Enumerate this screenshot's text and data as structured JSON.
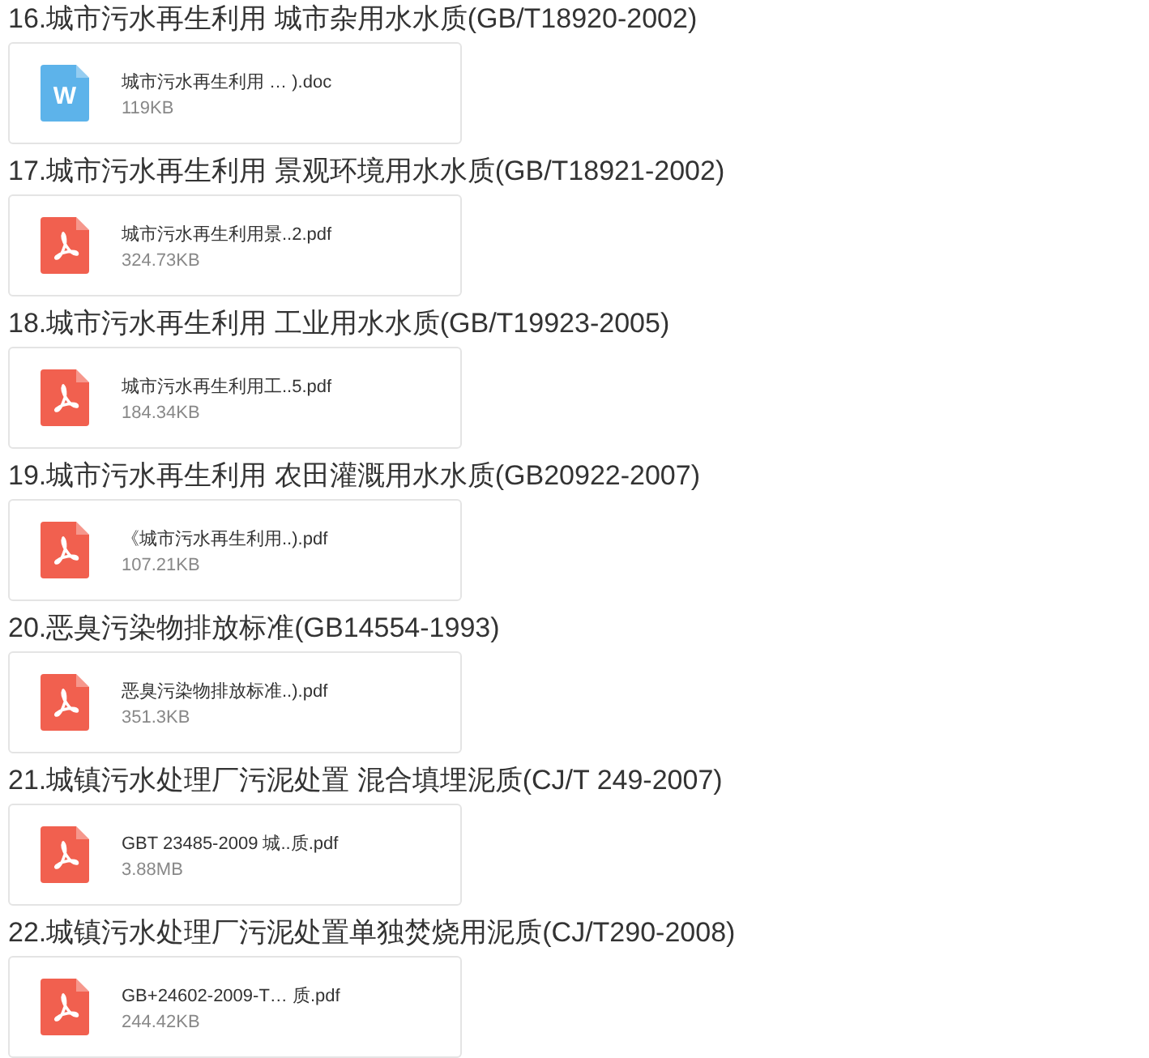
{
  "sections": [
    {
      "heading": "16.城市污水再生利用 城市杂用水水质(GB/T18920-2002)",
      "file": {
        "kind": "doc",
        "icon_label": "W",
        "name": "城市污水再生利用 … ).doc",
        "size": "119KB"
      }
    },
    {
      "heading": "17.城市污水再生利用 景观环境用水水质(GB/T18921-2002)",
      "file": {
        "kind": "pdf",
        "name": "城市污水再生利用景..2.pdf",
        "size": "324.73KB"
      }
    },
    {
      "heading": "18.城市污水再生利用 工业用水水质(GB/T19923-2005)",
      "file": {
        "kind": "pdf",
        "name": "城市污水再生利用工..5.pdf",
        "size": "184.34KB"
      }
    },
    {
      "heading": "19.城市污水再生利用 农田灌溉用水水质(GB20922-2007)",
      "file": {
        "kind": "pdf",
        "name": "《城市污水再生利用..).pdf",
        "size": "107.21KB"
      }
    },
    {
      "heading": "20.恶臭污染物排放标准(GB14554-1993)",
      "file": {
        "kind": "pdf",
        "name": "恶臭污染物排放标准..).pdf",
        "size": "351.3KB"
      }
    },
    {
      "heading": "21.城镇污水处理厂污泥处置 混合填埋泥质(CJ/T 249-2007)",
      "file": {
        "kind": "pdf",
        "name": "GBT 23485-2009 城..质.pdf",
        "size": "3.88MB"
      }
    },
    {
      "heading": "22.城镇污水处理厂污泥处置单独焚烧用泥质(CJ/T290-2008)",
      "file": {
        "kind": "pdf",
        "name": "GB+24602-2009-T… 质.pdf",
        "size": "244.42KB"
      }
    }
  ]
}
